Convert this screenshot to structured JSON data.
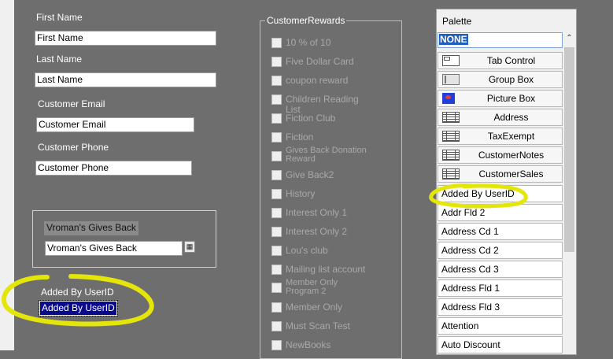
{
  "form": {
    "first_name": {
      "label": "First Name",
      "value": "First Name"
    },
    "last_name": {
      "label": "Last Name",
      "value": "Last Name"
    },
    "customer_email": {
      "label": "Customer Email",
      "value": "Customer Email"
    },
    "customer_phone": {
      "label": "Customer Phone",
      "value": "Customer Phone"
    },
    "gives_back": {
      "title": "Vroman's Gives Back",
      "value": "Vroman's Gives Back"
    },
    "added_by": {
      "label": "Added By UserID",
      "value": "Added By UserID"
    }
  },
  "rewards": {
    "legend": "CustomerRewards",
    "items": [
      "10 % of 10",
      "Five Dollar Card",
      "coupon reward",
      "Children Reading List",
      "Fiction Club",
      "Fiction",
      "Gives Back Donation Reward",
      "Give Back2",
      "History",
      "Interest Only 1",
      "Interest Only 2",
      "Lou's club",
      "Mailing list account",
      "Member Only Program 2",
      "Member Only",
      "Must Scan Test",
      "NewBooks"
    ]
  },
  "palette": {
    "title": "Palette",
    "filter": "NONE",
    "tools": [
      {
        "label": "Tab Control",
        "icon": "tab-control-icon"
      },
      {
        "label": "Group Box",
        "icon": "group-box-icon"
      },
      {
        "label": "Picture Box",
        "icon": "picture-box-icon"
      },
      {
        "label": "Address",
        "icon": "grid-icon"
      },
      {
        "label": "TaxExempt",
        "icon": "grid-icon"
      },
      {
        "label": "CustomerNotes",
        "icon": "grid-icon"
      },
      {
        "label": "CustomerSales",
        "icon": "grid-icon"
      }
    ],
    "fields": [
      "Added By UserID",
      "Addr Fld 2",
      "Address Cd 1",
      "Address Cd 2",
      "Address Cd 3",
      "Address Fld 1",
      "Address Fld 3",
      "Attention",
      "Auto Discount"
    ]
  },
  "colors": {
    "highlight": "#e4e60a",
    "selection": "#0a0a8c",
    "background": "#6e6e6e"
  }
}
